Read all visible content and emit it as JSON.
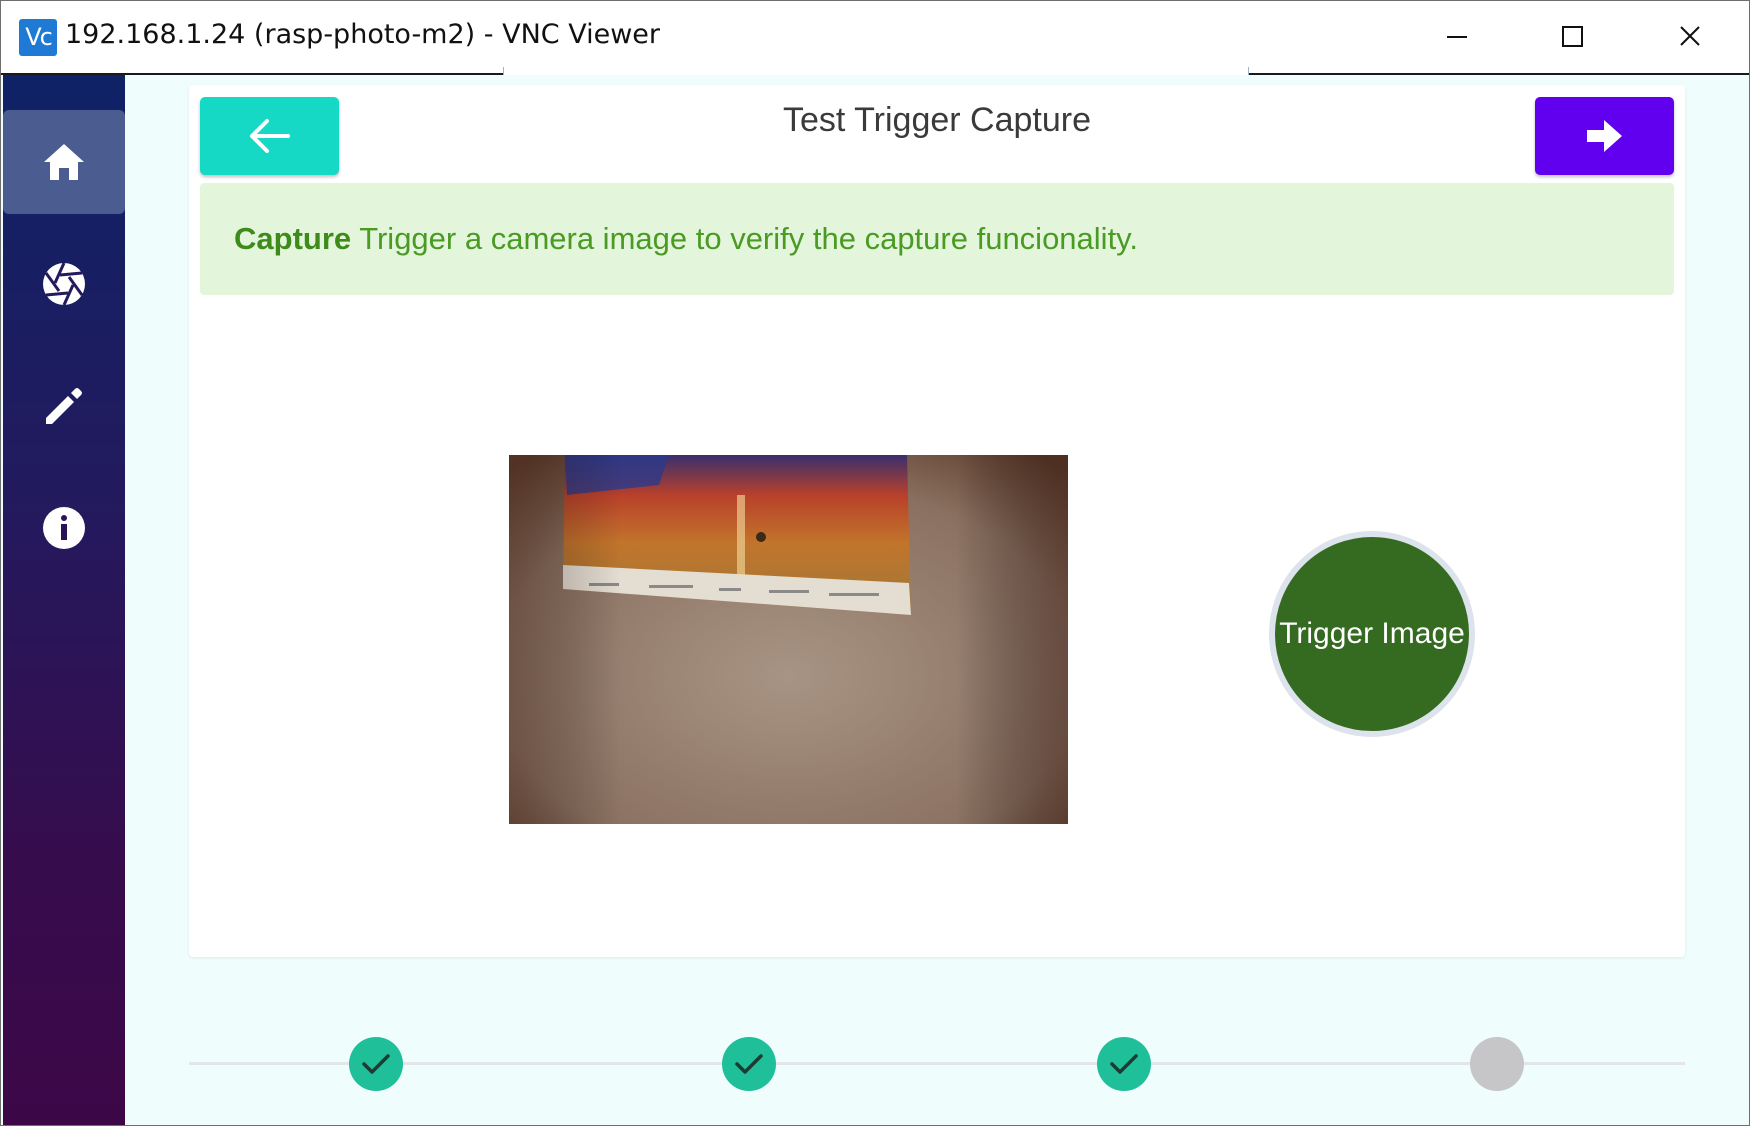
{
  "window": {
    "icon_text": "Vс",
    "title": "192.168.1.24 (rasp-photo-m2) - VNC Viewer"
  },
  "sidebar": {
    "items": [
      {
        "icon": "home-icon",
        "active": true
      },
      {
        "icon": "camera-aperture-icon",
        "active": false
      },
      {
        "icon": "pencil-icon",
        "active": false
      },
      {
        "icon": "info-icon",
        "active": false
      }
    ]
  },
  "header": {
    "title": "Test Trigger Capture"
  },
  "banner": {
    "strong": "Capture",
    "text": " Trigger a camera image to verify the capture funcionality."
  },
  "trigger": {
    "label": "Trigger Image"
  },
  "stepper": {
    "steps": [
      "done",
      "done",
      "done",
      "pending"
    ]
  },
  "colors": {
    "accent_back": "#15d9c4",
    "accent_next": "#6000ee",
    "banner_bg": "#e3f6dc",
    "banner_text": "#4a9a24",
    "trigger_bg": "#356a21",
    "step_done": "#1fbf9a",
    "step_pending": "#c6c6c8"
  }
}
